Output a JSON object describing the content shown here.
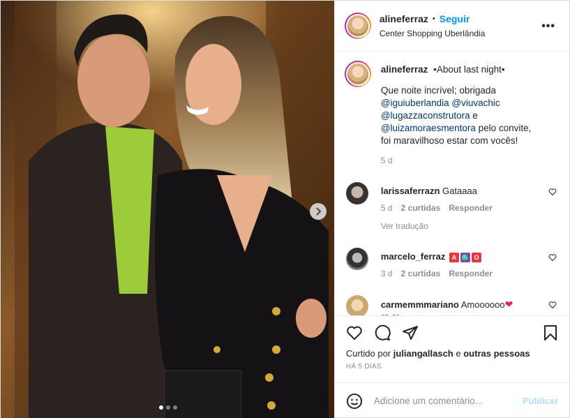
{
  "post": {
    "username": "alineferraz",
    "separator": "•",
    "follow_label": "Seguir",
    "location": "Center Shopping Uberlândia",
    "more_label": "•••"
  },
  "caption": {
    "username": "alineferraz",
    "title": "•About last night•",
    "text_intro": "Que noite incrível; obrigada",
    "mention1": "@iguiuberlandia",
    "mention2": "@viuvachic",
    "mention3": "@lugazzaconstrutora",
    "text_e": "e",
    "mention4": "@luizamoraesmentora",
    "text_end1": "pelo convite,",
    "text_end2": "foi maravilhoso estar com vocês!",
    "time": "5 d"
  },
  "comments": [
    {
      "username": "larissaferrazn",
      "text": "Gataaaa",
      "time": "5 d",
      "likes": "2 curtidas",
      "reply": "Responder",
      "translate": "Ver tradução"
    },
    {
      "username": "marcelo_ferraz",
      "text": "",
      "badges": [
        "A",
        "♏",
        "O"
      ],
      "time": "3 d",
      "likes": "2 curtidas",
      "reply": "Responder"
    },
    {
      "username": "carmemmmariano",
      "text": "Amoooooo",
      "hearts1": "❤",
      "hearts2": "❤ ❤"
    }
  ],
  "likes": {
    "prefix": "Curtido por",
    "user": "juliangallasch",
    "middle": "e",
    "others": "outras pessoas",
    "date": "HÁ 5 DIAS"
  },
  "add_comment": {
    "placeholder": "Adicione um comentário...",
    "publish_label": "Publicar"
  },
  "colors": {
    "follow_blue": "#0095f6",
    "mention_blue": "#00376b",
    "publish_disabled": "#b2dffc"
  },
  "carousel": {
    "total_slides": 3,
    "current_slide": 1
  }
}
